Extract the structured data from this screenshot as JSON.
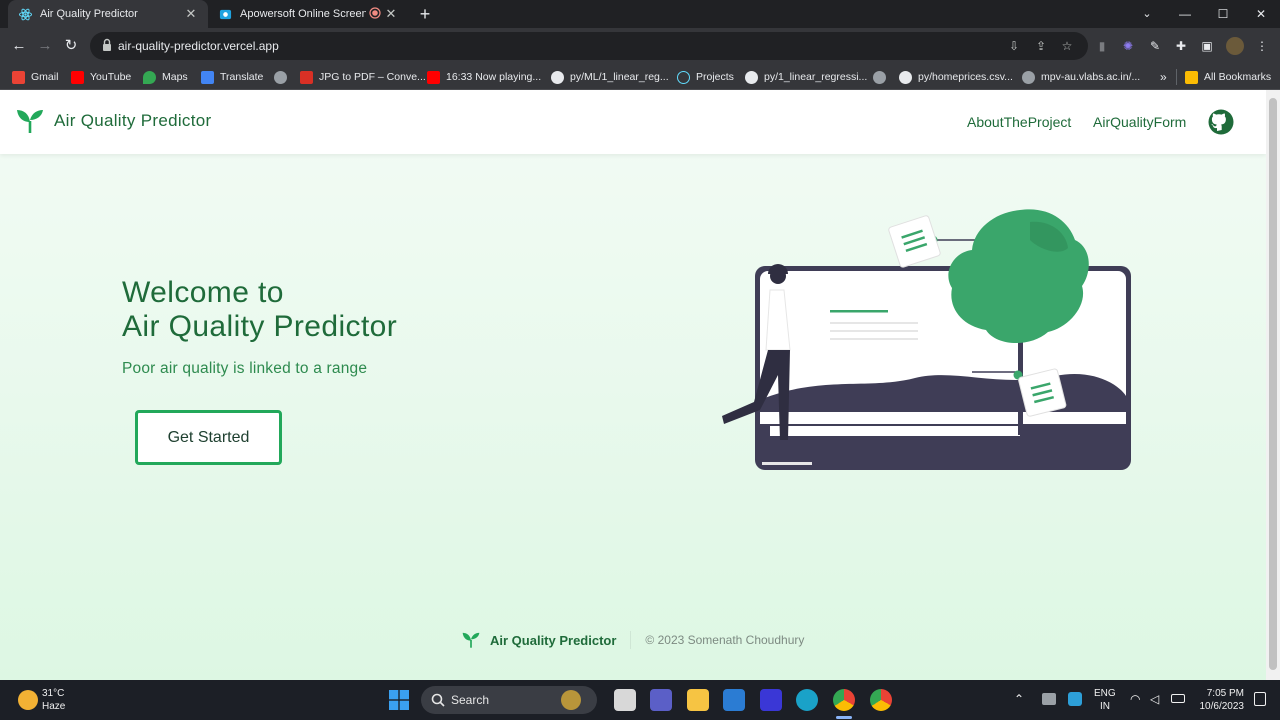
{
  "browser": {
    "tabs": [
      {
        "title": "Air Quality Predictor",
        "active": true
      },
      {
        "title": "Apowersoft Online Screen R",
        "active": false
      }
    ],
    "url": "air-quality-predictor.vercel.app",
    "window_controls": {
      "minimize": "—",
      "maximize": "☐",
      "close": "✕"
    },
    "bookmarks": [
      {
        "label": "Gmail",
        "color": "#ea4335"
      },
      {
        "label": "YouTube",
        "color": "#ff0000"
      },
      {
        "label": "Maps",
        "color": "#34a853"
      },
      {
        "label": "Translate",
        "color": "#4285f4"
      },
      {
        "label": "",
        "color": "#9aa0a6"
      },
      {
        "label": "JPG to PDF – Conve...",
        "color": "#d93025"
      },
      {
        "label": "16:33 Now playing...",
        "color": "#ff0000"
      },
      {
        "label": "py/ML/1_linear_reg...",
        "color": "#e8eaed"
      },
      {
        "label": "Projects",
        "color": "#61dafb"
      },
      {
        "label": "py/1_linear_regressi...",
        "color": "#e8eaed"
      },
      {
        "label": "",
        "color": "#9aa0a6"
      },
      {
        "label": "py/homeprices.csv...",
        "color": "#e8eaed"
      },
      {
        "label": "mpv-au.vlabs.ac.in/...",
        "color": "#9aa0a6"
      }
    ],
    "bookmarks_overflow": "»",
    "all_bookmarks": "All Bookmarks"
  },
  "site": {
    "brand": "Air Quality Predictor",
    "nav": [
      "AboutTheProject",
      "AirQualityForm"
    ],
    "hero": {
      "title_line1": "Welcome to",
      "title_line2": "Air Quality Predictor",
      "subtitle": "Poor air quality is linked to a range",
      "cta": "Get Started"
    },
    "footer": {
      "brand": "Air Quality Predictor",
      "copyright": "© 2023 Somenath Choudhury"
    }
  },
  "taskbar": {
    "weather_temp": "31°C",
    "weather_desc": "Haze",
    "search_label": "Search",
    "lang1": "ENG",
    "lang2": "IN",
    "time": "7:05 PM",
    "date": "10/6/2023"
  },
  "colors": {
    "brand_green": "#1f6b3a",
    "accent_green": "#22a85a",
    "illustration_green": "#3aa66b",
    "illustration_dark": "#3f3d56"
  }
}
